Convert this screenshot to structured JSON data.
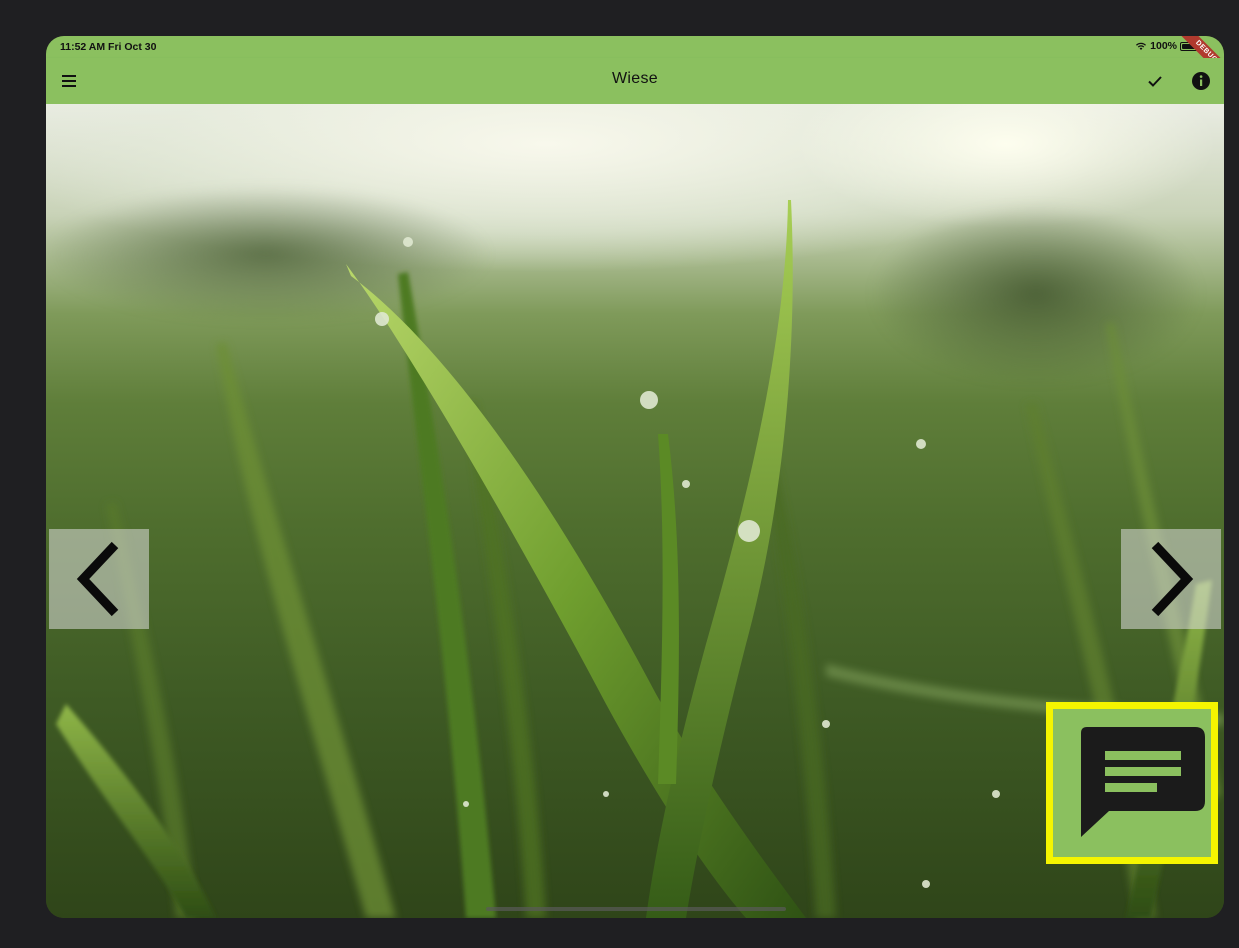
{
  "status_bar": {
    "time": "11:52 AM  Fri Oct 30",
    "battery": "100%",
    "debug_ribbon": "DEBUG"
  },
  "app_bar": {
    "title": "Wiese",
    "menu_icon": "menu-icon",
    "check_icon": "check-icon",
    "info_icon": "info-icon"
  },
  "photo": {
    "subject": "grass-photo"
  },
  "navigation": {
    "prev_icon": "chevron-left-icon",
    "next_icon": "chevron-right-icon"
  },
  "comment_button": {
    "icon": "comment-icon",
    "highlight_color": "#f5f500",
    "background_color": "#8bc05f"
  },
  "colors": {
    "accent": "#8bc05f",
    "highlight": "#f5f500"
  }
}
